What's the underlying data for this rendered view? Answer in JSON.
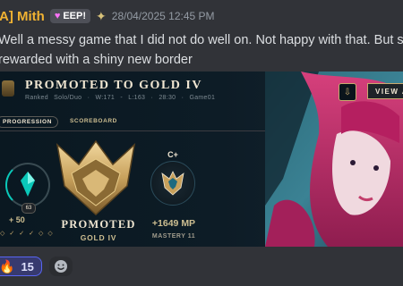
{
  "message": {
    "username": "[A] Mith",
    "badge": "EEP!",
    "timestamp": "28/04/2025 12:45 PM",
    "lines": [
      "Well a messy game that I did not do well on. Not happy with that. But s",
      "rewarded with a shiny new border"
    ]
  },
  "embed": {
    "title": "PROMOTED TO GOLD IV",
    "subtitle": "Ranked Solo/Duo · W:171 - L:163 · 28:30 · Game01",
    "view_button": "VIEW A",
    "tabs": [
      "PROGRESSION",
      "SCOREBOARD"
    ],
    "lp_badge": "63",
    "lp_change": "+ 50",
    "promoted": "PROMOTED",
    "rank": "GOLD IV",
    "grade": "C+",
    "mastery_points": "+1649 MP",
    "mastery_level": "MASTERY 11"
  },
  "reactions": [
    {
      "emoji": "fire-emoji",
      "count": "15"
    }
  ]
}
